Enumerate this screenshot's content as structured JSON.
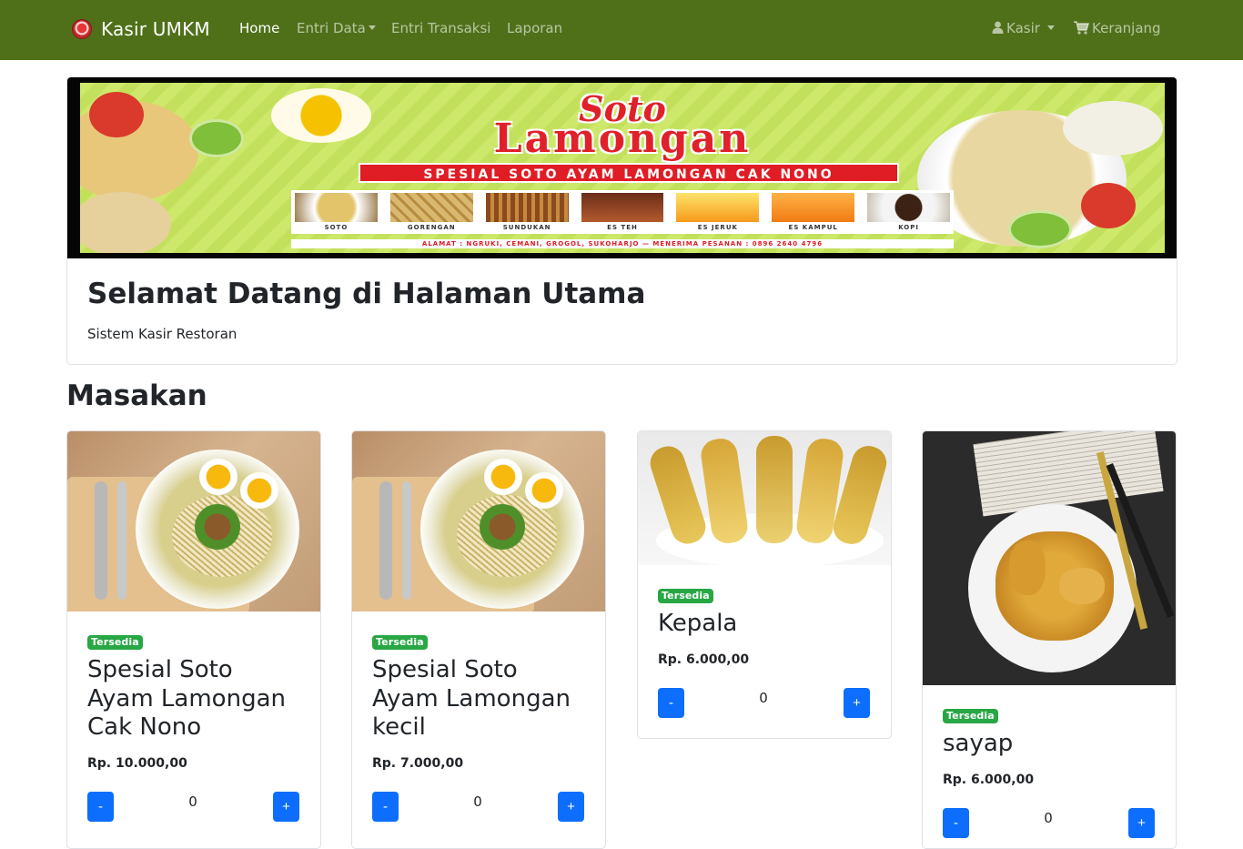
{
  "navbar": {
    "brand": "Kasir UMKM",
    "links": [
      {
        "label": "Home",
        "active": true,
        "dropdown": false
      },
      {
        "label": "Entri Data",
        "active": false,
        "dropdown": true
      },
      {
        "label": "Entri Transaksi",
        "active": false,
        "dropdown": false
      },
      {
        "label": "Laporan",
        "active": false,
        "dropdown": false
      }
    ],
    "user_label": "Kasir",
    "cart_label": "Keranjang",
    "bg_color": "#4f7019"
  },
  "hero": {
    "banner": {
      "title_line1": "Soto",
      "title_line2": "Lamongan",
      "tagline": "SPESIAL SOTO AYAM LAMONGAN CAK NONO",
      "menu_items": [
        "SOTO",
        "GORENGAN",
        "SUNDUKAN",
        "ES TEH",
        "ES JERUK",
        "ES KAMPUL",
        "KOPI"
      ],
      "address_line": "ALAMAT : NGRUKI, CEMANI, GROGOL, SUKOHARJO — MENERIMA PESANAN : 0896 2640 4796"
    },
    "title": "Selamat Datang di Halaman Utama",
    "subtitle": "Sistem Kasir Restoran"
  },
  "section_title": "Masakan",
  "products": [
    {
      "badge": "Tersedia",
      "name": "Spesial Soto Ayam Lamongan Cak Nono",
      "price": "Rp. 10.000,00",
      "qty": "0",
      "minus": "-",
      "plus": "+",
      "image": "soto-bowl"
    },
    {
      "badge": "Tersedia",
      "name": "Spesial Soto Ayam Lamongan kecil",
      "price": "Rp. 7.000,00",
      "qty": "0",
      "minus": "-",
      "plus": "+",
      "image": "soto-bowl"
    },
    {
      "badge": "Tersedia",
      "name": "Kepala",
      "price": "Rp. 6.000,00",
      "qty": "0",
      "minus": "-",
      "plus": "+",
      "image": "chicken-heads"
    },
    {
      "badge": "Tersedia",
      "name": "sayap",
      "price": "Rp. 6.000,00",
      "qty": "0",
      "minus": "-",
      "plus": "+",
      "image": "chicken-wings"
    }
  ],
  "colors": {
    "badge": "#28a745",
    "button": "#0d6efd",
    "banner_red": "#e01c24"
  }
}
